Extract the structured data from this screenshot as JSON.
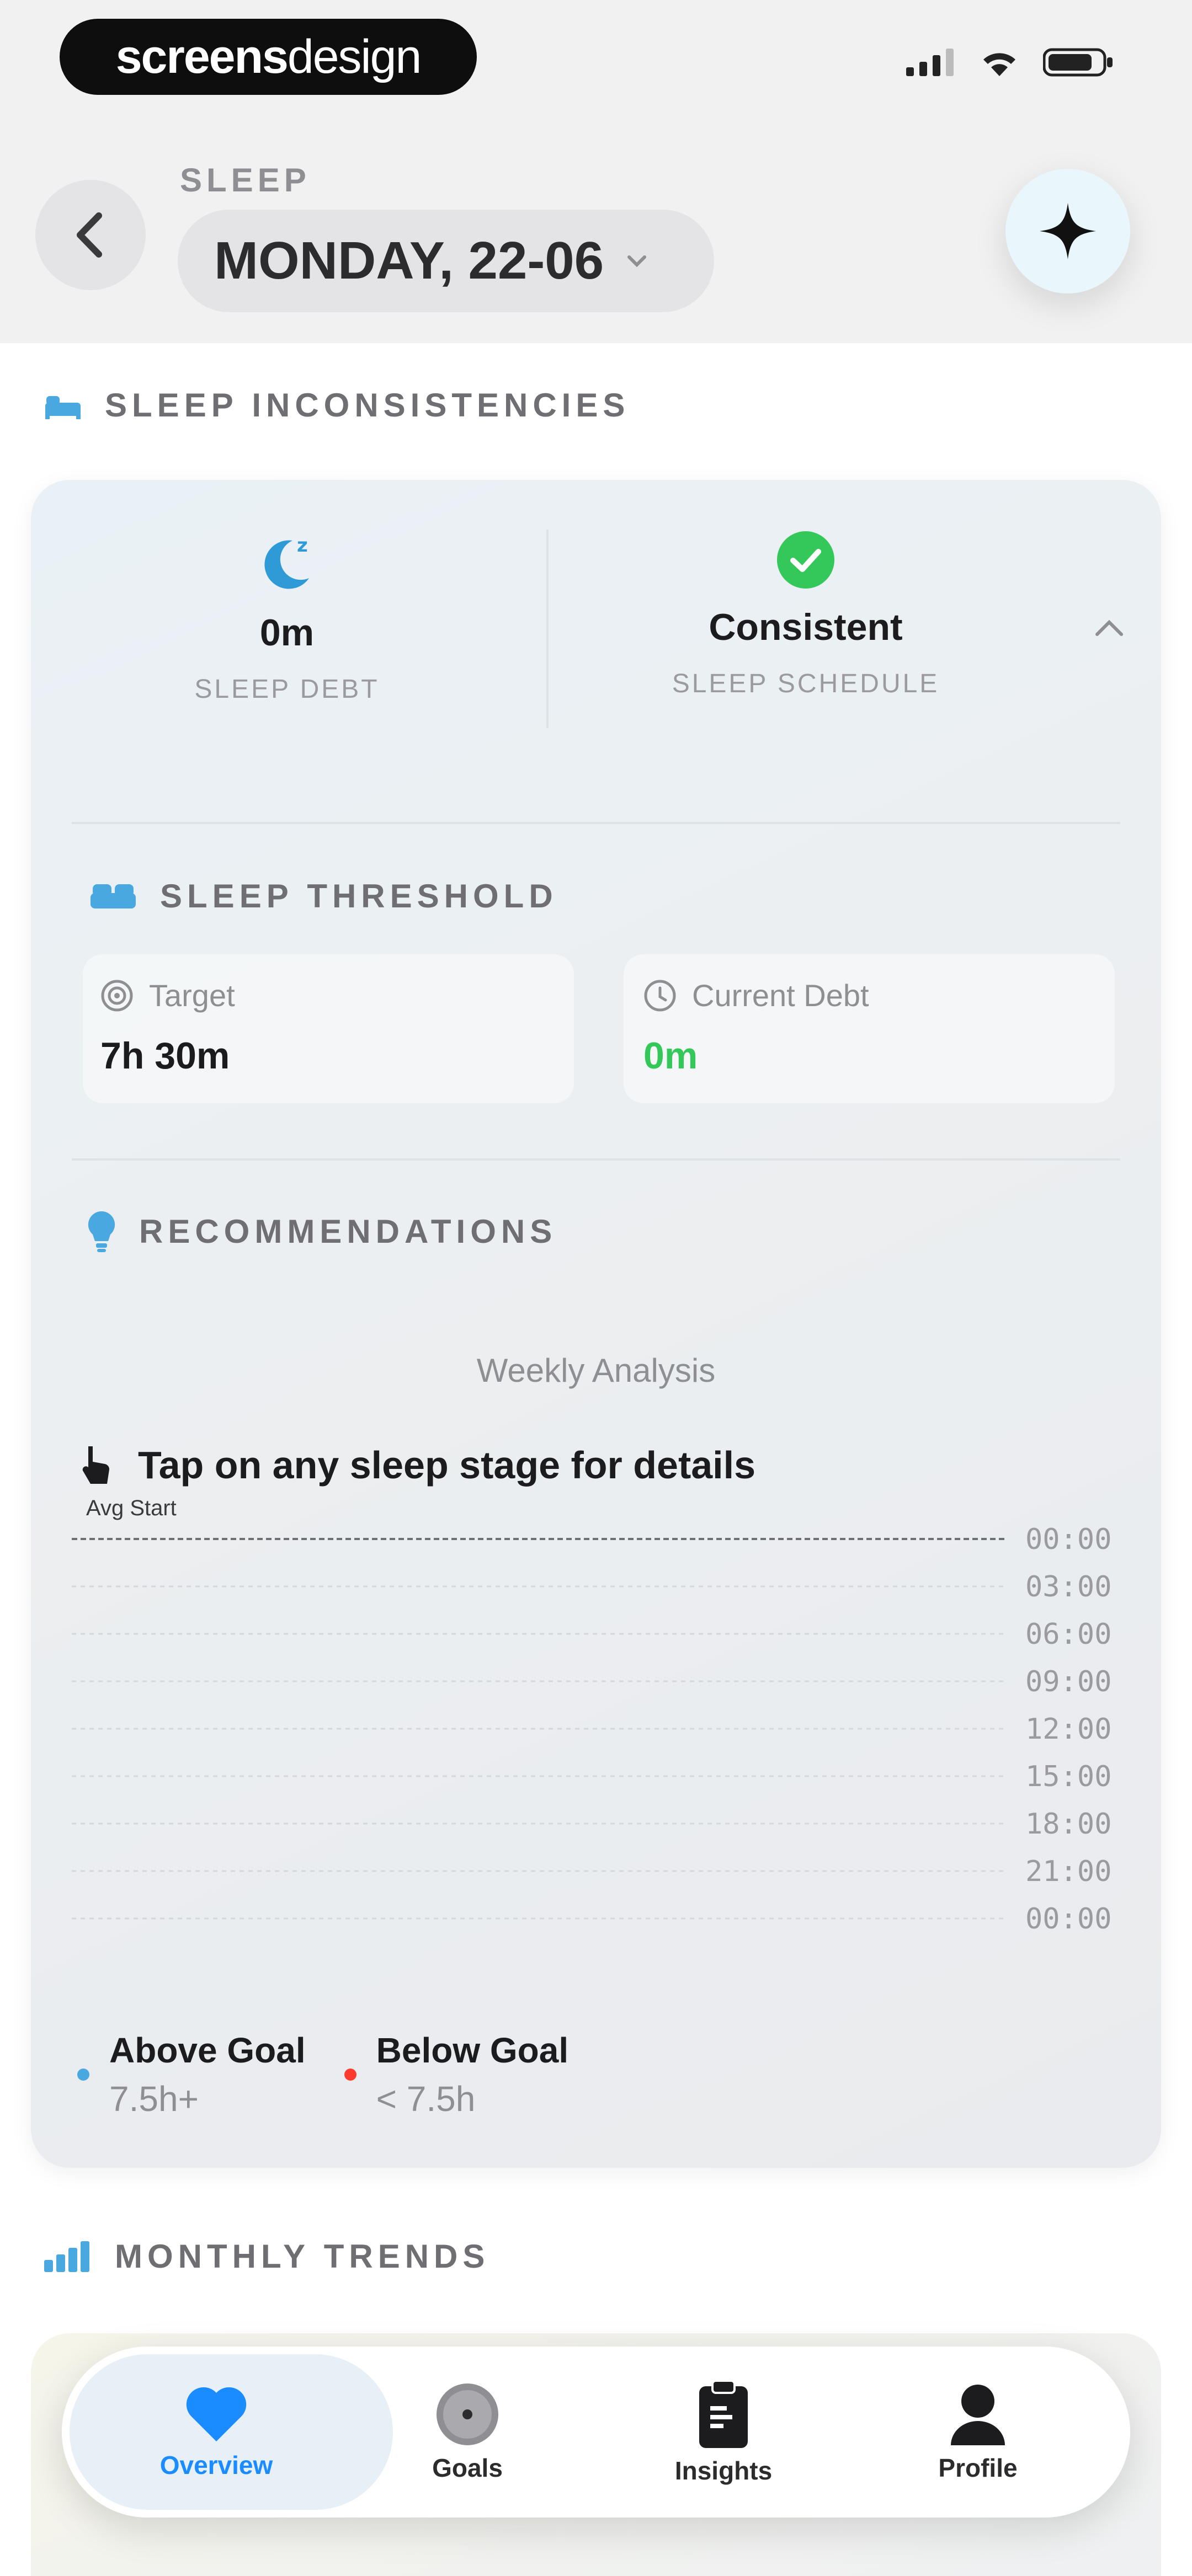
{
  "status_bar": {
    "logo_bold": "screens",
    "logo_light": "design"
  },
  "header": {
    "kicker": "SLEEP",
    "date": "MONDAY, 22-06"
  },
  "sleep_inconsistencies": {
    "title": "SLEEP INCONSISTENCIES",
    "sleep_debt": {
      "value": "0m",
      "label": "SLEEP DEBT"
    },
    "schedule": {
      "value": "Consistent",
      "label": "SLEEP SCHEDULE"
    }
  },
  "threshold": {
    "title": "SLEEP THRESHOLD",
    "target": {
      "label": "Target",
      "value": "7h 30m"
    },
    "current_debt": {
      "label": "Current Debt",
      "value": "0m"
    }
  },
  "recommendations": {
    "title": "RECOMMENDATIONS",
    "chart_caption": "Weekly Analysis",
    "tap_hint": "Tap on any sleep stage for details",
    "avg_label": "Avg Start"
  },
  "chart_data": {
    "type": "line",
    "title": "Weekly Analysis",
    "y_ticks": [
      "00:00",
      "03:00",
      "06:00",
      "09:00",
      "12:00",
      "15:00",
      "18:00",
      "21:00",
      "00:00"
    ],
    "series": [],
    "grid": true
  },
  "legend": {
    "above": {
      "title": "Above Goal",
      "sub": "7.5h+",
      "color": "#4aa8e0"
    },
    "below": {
      "title": "Below Goal",
      "sub": "< 7.5h",
      "color": "#ff3b30"
    }
  },
  "monthly_trends": {
    "title": "MONTHLY TRENDS"
  },
  "tabbar": {
    "tabs": [
      {
        "label": "Overview",
        "icon": "heart-icon",
        "active": true
      },
      {
        "label": "Goals",
        "icon": "target-icon",
        "active": false
      },
      {
        "label": "Insights",
        "icon": "clipboard-icon",
        "active": false
      },
      {
        "label": "Profile",
        "icon": "person-icon",
        "active": false
      }
    ]
  },
  "colors": {
    "accent": "#1a8cff",
    "success": "#34c759",
    "moon": "#2e9bd6"
  }
}
